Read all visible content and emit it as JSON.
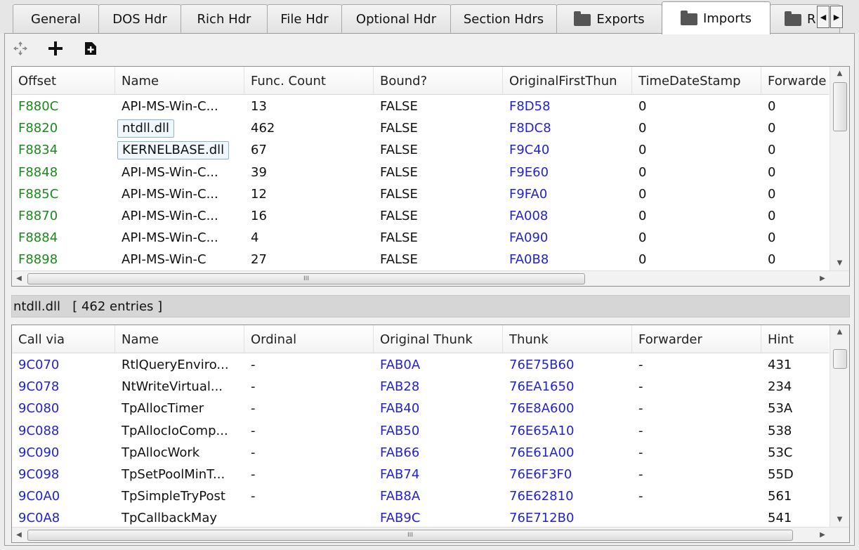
{
  "tabs": [
    {
      "label": "General"
    },
    {
      "label": "DOS Hdr"
    },
    {
      "label": "Rich Hdr"
    },
    {
      "label": "File Hdr"
    },
    {
      "label": "Optional Hdr"
    },
    {
      "label": "Section Hdrs"
    },
    {
      "label": "Exports",
      "icon": "folder-icon"
    },
    {
      "label": "Imports",
      "icon": "folder-icon",
      "active": true
    },
    {
      "label": "R",
      "icon": "folder-icon"
    }
  ],
  "toolbar": {
    "buttons": [
      {
        "icon": "move-icon"
      },
      {
        "icon": "plus-icon"
      },
      {
        "icon": "add-file-icon"
      }
    ]
  },
  "imports": {
    "columns": [
      "Offset",
      "Name",
      "Func. Count",
      "Bound?",
      "OriginalFirstThun",
      "TimeDateStamp",
      "Forwarde"
    ],
    "rows": [
      [
        "F880C",
        "API-MS-Win-C...",
        "13",
        "FALSE",
        "F8D58",
        "0",
        "0"
      ],
      [
        "F8820",
        "ntdll.dll",
        "462",
        "FALSE",
        "F8DC8",
        "0",
        "0"
      ],
      [
        "F8834",
        "KERNELBASE.dll",
        "67",
        "FALSE",
        "F9C40",
        "0",
        "0"
      ],
      [
        "F8848",
        "API-MS-Win-C...",
        "39",
        "FALSE",
        "F9E60",
        "0",
        "0"
      ],
      [
        "F885C",
        "API-MS-Win-C...",
        "12",
        "FALSE",
        "F9FA0",
        "0",
        "0"
      ],
      [
        "F8870",
        "API-MS-Win-C...",
        "16",
        "FALSE",
        "FA008",
        "0",
        "0"
      ],
      [
        "F8884",
        "API-MS-Win-C...",
        "4",
        "FALSE",
        "FA090",
        "0",
        "0"
      ],
      [
        "F8898",
        "API-MS-Win-C",
        "27",
        "FALSE",
        "FA0B8",
        "0",
        "0"
      ]
    ],
    "scroll_marker": "III"
  },
  "status": {
    "dll": "ntdll.dll",
    "entries": "[ 462 entries ]"
  },
  "functions": {
    "columns": [
      "Call via",
      "Name",
      "Ordinal",
      "Original Thunk",
      "Thunk",
      "Forwarder",
      "Hint"
    ],
    "rows": [
      [
        "9C070",
        "RtlQueryEnviro...",
        "-",
        "FAB0A",
        "76E75B60",
        "-",
        "431"
      ],
      [
        "9C078",
        "NtWriteVirtual...",
        "-",
        "FAB28",
        "76EA1650",
        "-",
        "234"
      ],
      [
        "9C080",
        "TpAllocTimer",
        "-",
        "FAB40",
        "76E8A600",
        "-",
        "53A"
      ],
      [
        "9C088",
        "TpAllocIoComp...",
        "-",
        "FAB50",
        "76E65A10",
        "-",
        "538"
      ],
      [
        "9C090",
        "TpAllocWork",
        "-",
        "FAB66",
        "76E61A00",
        "-",
        "53C"
      ],
      [
        "9C098",
        "TpSetPoolMinT...",
        "-",
        "FAB74",
        "76E6F3F0",
        "-",
        "55D"
      ],
      [
        "9C0A0",
        "TpSimpleTryPost",
        "-",
        "FAB8A",
        "76E62810",
        "-",
        "561"
      ],
      [
        "9C0A8",
        "TpCallbackMay",
        "",
        "FAB9C",
        "76E712B0",
        "",
        "541"
      ]
    ],
    "scroll_marker": "III"
  }
}
